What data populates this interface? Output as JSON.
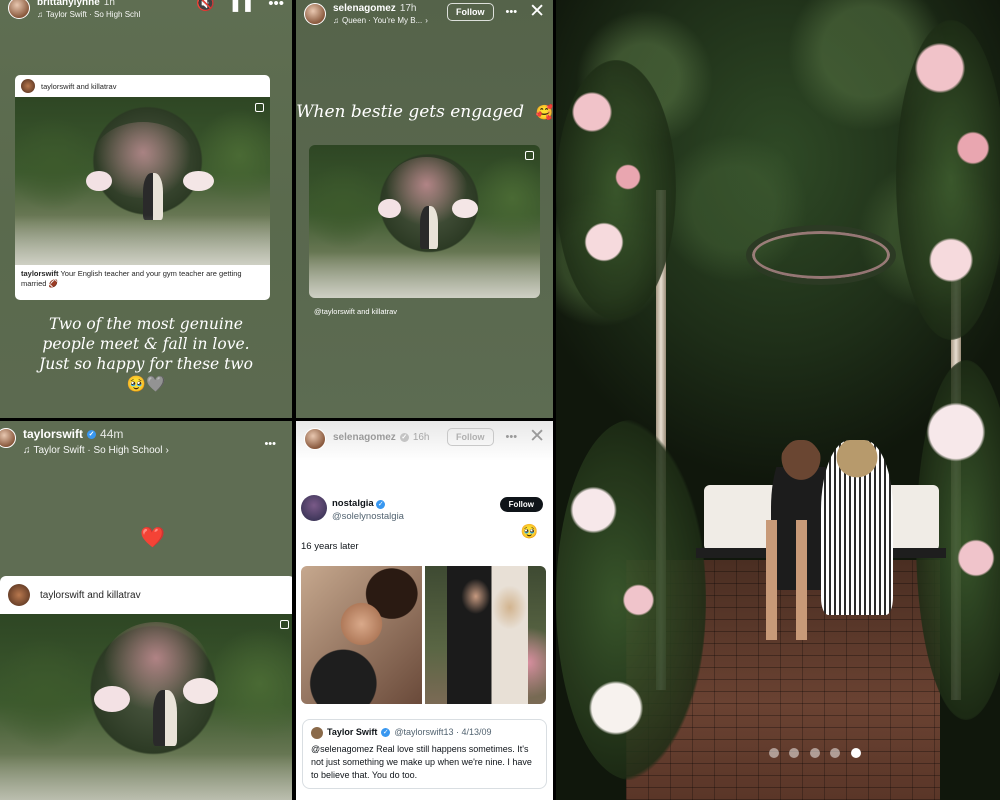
{
  "story_top_left": {
    "username": "brittanylynne",
    "time": "1h",
    "song": "Taylor Swift · So High Schl",
    "card_users": "taylorswift and killatrav",
    "card_caption_user": "taylorswift",
    "card_caption": "Your English teacher and your gym teacher are getting married 🏈",
    "caption_lines": [
      "Two of the most genuine",
      "people meet & fall in love.",
      "Just so happy for these two"
    ],
    "caption_emoji": "🥹🩶"
  },
  "story_top_mid": {
    "username": "selenagomez",
    "time": "17h",
    "song": "Queen · You're My B...",
    "follow_label": "Follow",
    "headline": "When bestie gets engaged",
    "headline_emoji": "🥰",
    "card_users": "@taylorswift and killatrav"
  },
  "story_bottom_left": {
    "username": "taylorswift",
    "time": "44m",
    "song": "Taylor Swift · So High School",
    "heart": "❤️",
    "card_users": "taylorswift and killatrav"
  },
  "story_bottom_mid": {
    "username": "selenagomez",
    "time": "16h",
    "follow_label": "Follow",
    "tweet": {
      "name": "nostalgia",
      "handle": "@solelynostalgia",
      "follow_label": "Follow",
      "text": "16 years later",
      "emoji": "🥹",
      "quote_name": "Taylor Swift",
      "quote_handle": "@taylorswift13 · 4/13/09",
      "quote_text": "@selenagomez Real love still happens sometimes. It's not just something we make up when we're nine. I have to believe that. You do too."
    }
  },
  "gallery": {
    "dots_total": 5,
    "active_dot": 5
  },
  "colors": {
    "story_bg": "#5f6e52",
    "verified": "#3897f0",
    "tweet_follow_bg": "#0f1419"
  },
  "icons": [
    "mute-icon",
    "pause-icon",
    "more-icon",
    "close-icon",
    "music-icon",
    "verified-icon",
    "carousel-icon",
    "heart-icon"
  ]
}
